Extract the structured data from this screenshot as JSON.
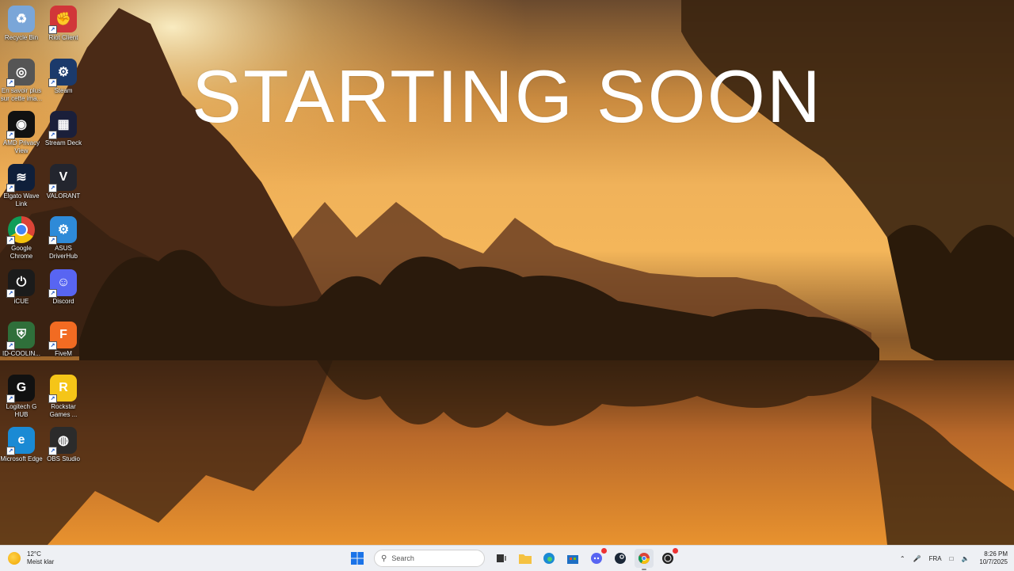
{
  "banner": {
    "text": "STARTING SOON"
  },
  "desktop_icons": [
    {
      "label": "Recycle Bin",
      "icon": "recycle-bin-icon",
      "color": "#7aa6d8",
      "glyph": "♻"
    },
    {
      "label": "Riot Client",
      "icon": "riot-client-icon",
      "color": "#d13639",
      "glyph": "✊"
    },
    {
      "label": "En savoir plus sur cette ima...",
      "icon": "learn-more-icon",
      "color": "#555555",
      "glyph": "◎"
    },
    {
      "label": "Steam",
      "icon": "steam-icon",
      "color": "#1b3a6b",
      "glyph": "⚙"
    },
    {
      "label": "AMD Privacy View",
      "icon": "amd-privacy-view-icon",
      "color": "#111111",
      "glyph": "◉"
    },
    {
      "label": "Stream Deck",
      "icon": "stream-deck-icon",
      "color": "#1a1f3a",
      "glyph": "▦"
    },
    {
      "label": "Elgato Wave Link",
      "icon": "wave-link-icon",
      "color": "#0f1f3a",
      "glyph": "≋"
    },
    {
      "label": "VALORANT",
      "icon": "valorant-icon",
      "color": "#23252e",
      "glyph": "V"
    },
    {
      "label": "Google Chrome",
      "icon": "chrome-icon",
      "color": "#ffffff",
      "glyph": ""
    },
    {
      "label": "ASUS DriverHub",
      "icon": "asus-driverhub-icon",
      "color": "#2e8ad8",
      "glyph": "⚙"
    },
    {
      "label": "iCUE",
      "icon": "icue-icon",
      "color": "#1b1b1b",
      "glyph": "⏻"
    },
    {
      "label": "Discord",
      "icon": "discord-icon",
      "color": "#5865f2",
      "glyph": "☺"
    },
    {
      "label": "ID-COOLIN...",
      "icon": "id-cooling-icon",
      "color": "#2f6f3a",
      "glyph": "⛨"
    },
    {
      "label": "FiveM",
      "icon": "fivem-icon",
      "color": "#f26b22",
      "glyph": "F"
    },
    {
      "label": "Logitech G HUB",
      "icon": "logitech-ghub-icon",
      "color": "#111111",
      "glyph": "G"
    },
    {
      "label": "Rockstar Games ...",
      "icon": "rockstar-icon",
      "color": "#f5c518",
      "glyph": "R"
    },
    {
      "label": "Microsoft Edge",
      "icon": "edge-icon",
      "color": "#1a8ad4",
      "glyph": "e"
    },
    {
      "label": "OBS Studio",
      "icon": "obs-studio-icon",
      "color": "#2b2b2b",
      "glyph": "◍"
    }
  ],
  "taskbar": {
    "weather": {
      "temp": "12°C",
      "desc": "Meist klar"
    },
    "search_placeholder": "Search",
    "apps": [
      {
        "name": "start-button",
        "icon": "windows-start-icon"
      },
      {
        "name": "task-view",
        "icon": "task-view-icon"
      },
      {
        "name": "file-explorer",
        "icon": "folder-icon"
      },
      {
        "name": "edge",
        "icon": "edge-icon"
      },
      {
        "name": "microsoft-store",
        "icon": "store-icon"
      },
      {
        "name": "discord",
        "icon": "discord-icon"
      },
      {
        "name": "steam",
        "icon": "steam-icon"
      },
      {
        "name": "chrome",
        "icon": "chrome-icon"
      },
      {
        "name": "obs",
        "icon": "obs-icon"
      }
    ],
    "tray": {
      "language": "FRA",
      "time": "8:26 PM",
      "date": "10/7/2025"
    }
  }
}
